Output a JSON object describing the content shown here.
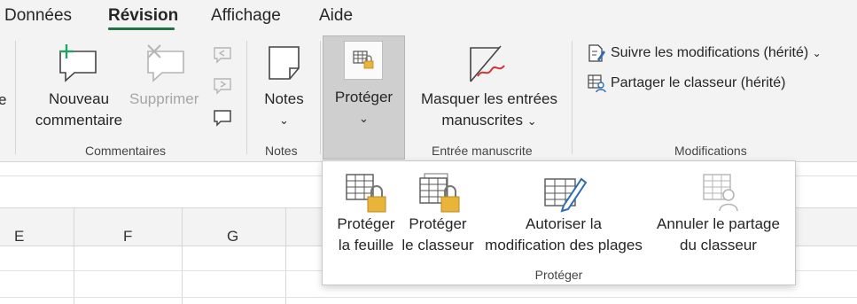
{
  "tabs": [
    {
      "label": "Données",
      "active": false
    },
    {
      "label": "Révision",
      "active": true
    },
    {
      "label": "Affichage",
      "active": false
    },
    {
      "label": "Aide",
      "active": false
    }
  ],
  "ribbon": {
    "partial_left_label": "e",
    "comments": {
      "new_line1": "Nouveau",
      "new_line2": "commentaire",
      "delete": "Supprimer",
      "group": "Commentaires"
    },
    "notes": {
      "button": "Notes",
      "group": "Notes"
    },
    "protect": {
      "button": "Protéger"
    },
    "ink": {
      "line1": "Masquer les entrées",
      "line2": "manuscrites",
      "group": "Entrée manuscrite"
    },
    "changes": {
      "track": "Suivre les modifications (hérité)",
      "share": "Partager le classeur (hérité)",
      "group": "Modifications"
    }
  },
  "protect_menu": {
    "items": [
      {
        "line1": "Protéger",
        "line2": "la feuille",
        "enabled": true
      },
      {
        "line1": "Protéger",
        "line2": "le classeur",
        "enabled": true
      },
      {
        "line1": "Autoriser la",
        "line2": "modification des plages",
        "enabled": true
      },
      {
        "line1": "Annuler le partage",
        "line2": "du classeur",
        "enabled": false
      }
    ],
    "group": "Protéger"
  },
  "sheet": {
    "columns": [
      "E",
      "F",
      "G"
    ]
  },
  "colors": {
    "accent": "#217346",
    "lock": "#e8b53a",
    "ink_red": "#d13438",
    "pen_blue": "#2b6cb5",
    "disabled": "#a6a6a6"
  }
}
